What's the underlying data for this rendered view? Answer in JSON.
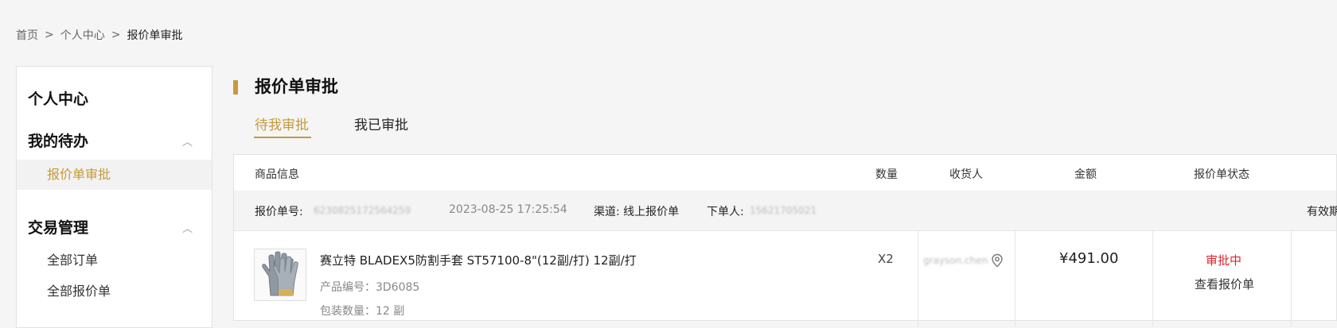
{
  "breadcrumb": {
    "home": "首页",
    "center": "个人中心",
    "current": "报价单审批",
    "sep": ">"
  },
  "sidebar": {
    "personal_center": "个人中心",
    "todo": {
      "title": "我的待办",
      "items": [
        "报价单审批"
      ]
    },
    "trade": {
      "title": "交易管理",
      "items": [
        "全部订单",
        "全部报价单"
      ]
    },
    "toggle_glyph": "︿"
  },
  "main": {
    "title": "报价单审批",
    "tabs": [
      {
        "label": "待我审批",
        "active": true
      },
      {
        "label": "我已审批",
        "active": false
      }
    ],
    "table": {
      "headers": [
        "商品信息",
        "数量",
        "收货人",
        "金额",
        "报价单状态"
      ],
      "order": {
        "number_label": "报价单号:",
        "number": "6230825172564259",
        "datetime": "2023-08-25 17:25:54",
        "channel": "渠道: 线上报价单",
        "placer_label": "下单人:",
        "placer": "15621705021",
        "validity_partial": "有效期"
      },
      "item": {
        "name": "赛立特  BLADEX5防割手套 ST57100-8\"(12副/打) 12副/打",
        "code": "产品编号：3D6085",
        "pack": "包装数量：12 副",
        "qty": "X2",
        "receiver": "grayson.chen",
        "amount": "¥491.00",
        "status": "审批中",
        "view_label": "查看报价单"
      }
    }
  },
  "colors": {
    "accent": "#c49a3c",
    "status_red": "#e0262b"
  }
}
